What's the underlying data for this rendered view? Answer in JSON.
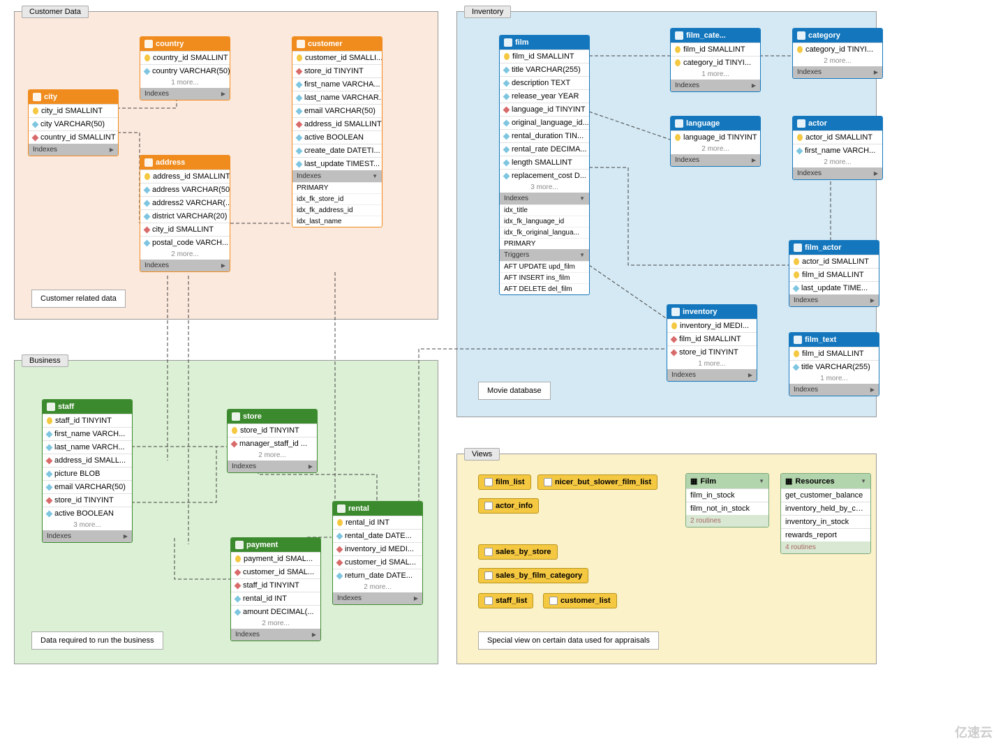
{
  "regions": {
    "customer": {
      "label": "Customer Data",
      "note": "Customer related data"
    },
    "inventory": {
      "label": "Inventory",
      "note": "Movie database"
    },
    "business": {
      "label": "Business",
      "note": "Data required to run the business"
    },
    "views": {
      "label": "Views",
      "note": "Special view on certain data used for appraisals"
    }
  },
  "tables": {
    "city": {
      "title": "city",
      "cols": [
        {
          "k": "pk",
          "t": "city_id SMALLINT"
        },
        {
          "k": "nm",
          "t": "city VARCHAR(50)"
        },
        {
          "k": "fk",
          "t": "country_id SMALLINT"
        }
      ],
      "sections": [
        {
          "name": "Indexes",
          "expanded": false
        }
      ]
    },
    "country": {
      "title": "country",
      "cols": [
        {
          "k": "pk",
          "t": "country_id SMALLINT"
        },
        {
          "k": "nm",
          "t": "country VARCHAR(50)"
        }
      ],
      "more": "1 more...",
      "sections": [
        {
          "name": "Indexes",
          "expanded": false
        }
      ]
    },
    "customer": {
      "title": "customer",
      "cols": [
        {
          "k": "pk",
          "t": "customer_id SMALLI..."
        },
        {
          "k": "fk",
          "t": "store_id TINYINT"
        },
        {
          "k": "nm",
          "t": "first_name VARCHA..."
        },
        {
          "k": "nm",
          "t": "last_name VARCHAR..."
        },
        {
          "k": "nm",
          "t": "email VARCHAR(50)"
        },
        {
          "k": "fk",
          "t": "address_id SMALLINT"
        },
        {
          "k": "nm",
          "t": "active BOOLEAN"
        },
        {
          "k": "nm",
          "t": "create_date DATETI..."
        },
        {
          "k": "nm",
          "t": "last_update TIMEST..."
        }
      ],
      "sections": [
        {
          "name": "Indexes",
          "expanded": true,
          "rows": [
            "PRIMARY",
            "idx_fk_store_id",
            "idx_fk_address_id",
            "idx_last_name"
          ]
        }
      ]
    },
    "address": {
      "title": "address",
      "cols": [
        {
          "k": "pk",
          "t": "address_id SMALLINT"
        },
        {
          "k": "nm",
          "t": "address VARCHAR(50)"
        },
        {
          "k": "nm",
          "t": "address2 VARCHAR(..."
        },
        {
          "k": "nm",
          "t": "district VARCHAR(20)"
        },
        {
          "k": "fk",
          "t": "city_id SMALLINT"
        },
        {
          "k": "nm",
          "t": "postal_code VARCH..."
        }
      ],
      "more": "2 more...",
      "sections": [
        {
          "name": "Indexes",
          "expanded": false
        }
      ]
    },
    "film": {
      "title": "film",
      "cols": [
        {
          "k": "pk",
          "t": "film_id SMALLINT"
        },
        {
          "k": "nm",
          "t": "title VARCHAR(255)"
        },
        {
          "k": "nm",
          "t": "description TEXT"
        },
        {
          "k": "nm",
          "t": "release_year YEAR"
        },
        {
          "k": "fk",
          "t": "language_id TINYINT"
        },
        {
          "k": "nm",
          "t": "original_language_id..."
        },
        {
          "k": "nm",
          "t": "rental_duration TIN..."
        },
        {
          "k": "nm",
          "t": "rental_rate DECIMA..."
        },
        {
          "k": "nm",
          "t": "length SMALLINT"
        },
        {
          "k": "nm",
          "t": "replacement_cost D..."
        }
      ],
      "more": "3 more...",
      "sections": [
        {
          "name": "Indexes",
          "expanded": true,
          "rows": [
            "idx_title",
            "idx_fk_language_id",
            "idx_fk_original_langua...",
            "PRIMARY"
          ]
        },
        {
          "name": "Triggers",
          "expanded": true,
          "rows": [
            "AFT UPDATE upd_film",
            "AFT INSERT ins_film",
            "AFT DELETE del_film"
          ]
        }
      ]
    },
    "film_category": {
      "title": "film_cate...",
      "cols": [
        {
          "k": "pk",
          "t": "film_id SMALLINT"
        },
        {
          "k": "pk",
          "t": "category_id TINYI..."
        }
      ],
      "more": "1 more...",
      "sections": [
        {
          "name": "Indexes",
          "expanded": false
        }
      ]
    },
    "category": {
      "title": "category",
      "cols": [
        {
          "k": "pk",
          "t": "category_id TINYI..."
        }
      ],
      "more": "2 more...",
      "sections": [
        {
          "name": "Indexes",
          "expanded": false
        }
      ]
    },
    "language": {
      "title": "language",
      "cols": [
        {
          "k": "pk",
          "t": "language_id TINYINT"
        }
      ],
      "more": "2 more...",
      "sections": [
        {
          "name": "Indexes",
          "expanded": false
        }
      ]
    },
    "actor": {
      "title": "actor",
      "cols": [
        {
          "k": "pk",
          "t": "actor_id SMALLINT"
        },
        {
          "k": "nm",
          "t": "first_name VARCH..."
        }
      ],
      "more": "2 more...",
      "sections": [
        {
          "name": "Indexes",
          "expanded": false
        }
      ]
    },
    "film_actor": {
      "title": "film_actor",
      "cols": [
        {
          "k": "pk",
          "t": "actor_id SMALLINT"
        },
        {
          "k": "pk",
          "t": "film_id SMALLINT"
        },
        {
          "k": "nm",
          "t": "last_update TIME..."
        }
      ],
      "sections": [
        {
          "name": "Indexes",
          "expanded": false
        }
      ]
    },
    "inventory_t": {
      "title": "inventory",
      "cols": [
        {
          "k": "pk",
          "t": "inventory_id MEDI..."
        },
        {
          "k": "fk",
          "t": "film_id SMALLINT"
        },
        {
          "k": "fk",
          "t": "store_id TINYINT"
        }
      ],
      "more": "1 more...",
      "sections": [
        {
          "name": "Indexes",
          "expanded": false
        }
      ]
    },
    "film_text": {
      "title": "film_text",
      "cols": [
        {
          "k": "pk",
          "t": "film_id SMALLINT"
        },
        {
          "k": "nm",
          "t": "title VARCHAR(255)"
        }
      ],
      "more": "1 more...",
      "sections": [
        {
          "name": "Indexes",
          "expanded": false
        }
      ]
    },
    "staff": {
      "title": "staff",
      "cols": [
        {
          "k": "pk",
          "t": "staff_id TINYINT"
        },
        {
          "k": "nm",
          "t": "first_name VARCH..."
        },
        {
          "k": "nm",
          "t": "last_name VARCH..."
        },
        {
          "k": "fk",
          "t": "address_id SMALL..."
        },
        {
          "k": "nm",
          "t": "picture BLOB"
        },
        {
          "k": "nm",
          "t": "email VARCHAR(50)"
        },
        {
          "k": "fk",
          "t": "store_id TINYINT"
        },
        {
          "k": "nm",
          "t": "active BOOLEAN"
        }
      ],
      "more": "3 more...",
      "sections": [
        {
          "name": "Indexes",
          "expanded": false
        }
      ]
    },
    "store": {
      "title": "store",
      "cols": [
        {
          "k": "pk",
          "t": "store_id TINYINT"
        },
        {
          "k": "fk",
          "t": "manager_staff_id ..."
        }
      ],
      "more": "2 more...",
      "sections": [
        {
          "name": "Indexes",
          "expanded": false
        }
      ]
    },
    "payment": {
      "title": "payment",
      "cols": [
        {
          "k": "pk",
          "t": "payment_id SMAL..."
        },
        {
          "k": "fk",
          "t": "customer_id SMAL..."
        },
        {
          "k": "fk",
          "t": "staff_id TINYINT"
        },
        {
          "k": "nm",
          "t": "rental_id INT"
        },
        {
          "k": "nm",
          "t": "amount DECIMAL(..."
        }
      ],
      "more": "2 more...",
      "sections": [
        {
          "name": "Indexes",
          "expanded": false
        }
      ]
    },
    "rental": {
      "title": "rental",
      "cols": [
        {
          "k": "pk",
          "t": "rental_id INT"
        },
        {
          "k": "nm",
          "t": "rental_date DATE..."
        },
        {
          "k": "fk",
          "t": "inventory_id MEDI..."
        },
        {
          "k": "fk",
          "t": "customer_id SMAL..."
        },
        {
          "k": "nm",
          "t": "return_date DATE..."
        }
      ],
      "more": "2 more...",
      "sections": [
        {
          "name": "Indexes",
          "expanded": false
        }
      ]
    }
  },
  "views": [
    "film_list",
    "nicer_but_slower_film_list",
    "actor_info",
    "sales_by_store",
    "sales_by_film_category",
    "staff_list",
    "customer_list"
  ],
  "routines": {
    "film": {
      "title": "Film",
      "rows": [
        "film_in_stock",
        "film_not_in_stock"
      ],
      "more": "2 routines"
    },
    "resources": {
      "title": "Resources",
      "rows": [
        "get_customer_balance",
        "inventory_held_by_cu...",
        "inventory_in_stock",
        "rewards_report"
      ],
      "more": "4 routines"
    }
  },
  "watermark": "亿速云"
}
